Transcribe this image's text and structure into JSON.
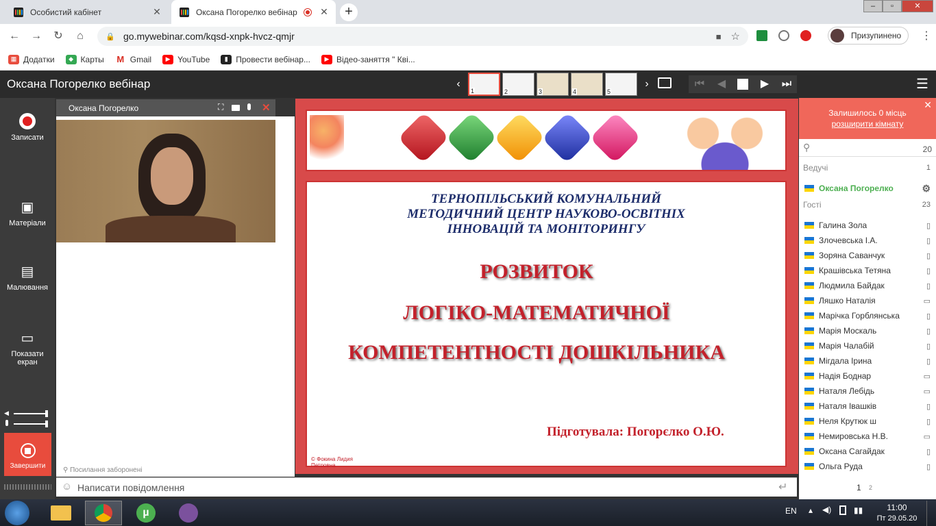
{
  "browser": {
    "tabs": [
      {
        "title": "Особистий кабінет"
      },
      {
        "title": "Оксана Погорелко вебінар"
      }
    ],
    "url": "go.mywebinar.com/kqsd-xnpk-hvcz-qmjr",
    "profile_label": "Призупинено",
    "bookmarks": [
      "Додатки",
      "Карты",
      "Gmail",
      "YouTube",
      "Провести вебінар...",
      "Відео-заняття \" Кві..."
    ]
  },
  "app": {
    "title": "Оксана Погорелко вебінар",
    "slide_numbers": [
      "1",
      "2",
      "3",
      "4",
      "5"
    ]
  },
  "sidebar": {
    "record": "Записати",
    "materials": "Матеріали",
    "drawing": "Малювання",
    "share_line1": "Показати",
    "share_line2": "екран",
    "finish": "Завершити"
  },
  "video": {
    "name": "Оксана Погорелко",
    "links_note": "Посилання заборонені"
  },
  "slide": {
    "org_line1": "ТЕРНОПІЛЬСЬКИЙ КОМУНАЛЬНИЙ",
    "org_line2": "МЕТОДИЧНИЙ  ЦЕНТР НАУКОВО-ОСВІТНІХ",
    "org_line3": "ІННОВАЦІЙ  ТА   МОНІТОРИНГУ",
    "title1": "РОЗВИТОК",
    "title2": "ЛОГІКО-МАТЕМАТИЧНОЇ",
    "title3": "КОМПЕТЕНТНОСТІ  ДОШКІЛЬНИКА",
    "author": "Підготувала:  Погорєлко О.Ю.",
    "copyright_line1": "© Фокина Лидия",
    "copyright_line2": "Петровна"
  },
  "chat": {
    "placeholder": "Написати повідомлення"
  },
  "participants_panel": {
    "seats_left": "Залишилось 0 місць",
    "expand_room": "розширити кімнату",
    "total_count": "20",
    "hosts_label": "Ведучі",
    "hosts_count": "1",
    "host_name": "Оксана Погорелко",
    "guests_label": "Гості",
    "guests_count": "23",
    "guests": [
      {
        "name": "Галина Зола",
        "device": "mobile"
      },
      {
        "name": "Злочевська І.А.",
        "device": "mobile"
      },
      {
        "name": "Зоряна Саванчук",
        "device": "mobile"
      },
      {
        "name": "Крашівська Тетяна",
        "device": "mobile"
      },
      {
        "name": "Людмила Байдак",
        "device": "mobile"
      },
      {
        "name": "Ляшко Наталія",
        "device": "desktop"
      },
      {
        "name": "Марічка Горблянська",
        "device": "mobile"
      },
      {
        "name": "Марія Москаль",
        "device": "mobile"
      },
      {
        "name": "Марія Чалабій",
        "device": "mobile"
      },
      {
        "name": "Мігдала Ірина",
        "device": "mobile"
      },
      {
        "name": "Надія Боднар",
        "device": "desktop"
      },
      {
        "name": "Наталя Лебідь",
        "device": "desktop"
      },
      {
        "name": "Наталя Івашків",
        "device": "mobile"
      },
      {
        "name": "Неля Крутюк ш",
        "device": "mobile"
      },
      {
        "name": "Немировська Н.В.",
        "device": "desktop"
      },
      {
        "name": "Оксана Сагайдак",
        "device": "mobile"
      },
      {
        "name": "Ольга Руда",
        "device": "mobile"
      }
    ],
    "pages": [
      "1",
      "2"
    ]
  },
  "taskbar": {
    "lang": "EN",
    "time": "11:00",
    "date": "Пт 29.05.20"
  },
  "colors": {
    "accent_red": "#e84c3d",
    "host_green": "#4caf50",
    "slide_red": "#c3212b",
    "slide_blue": "#1d2d6b"
  }
}
